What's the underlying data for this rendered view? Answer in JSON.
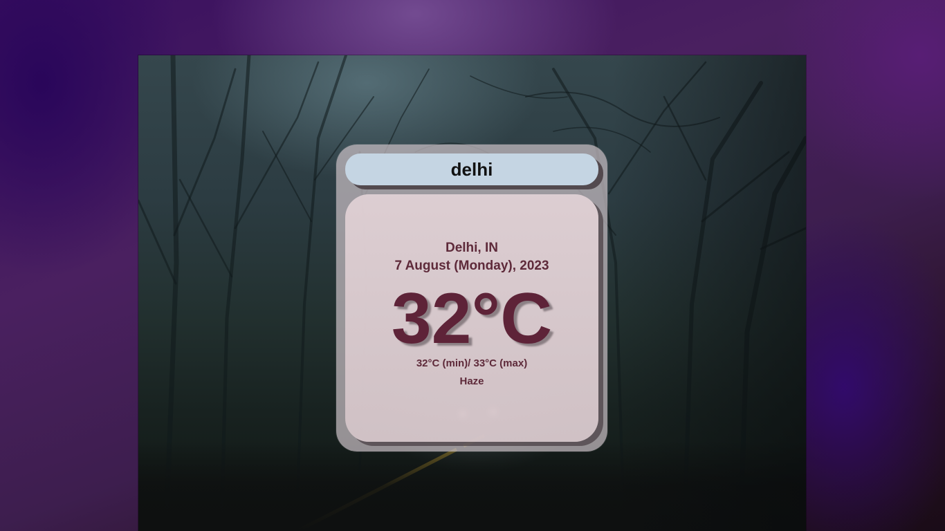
{
  "search": {
    "value": "delhi"
  },
  "weather": {
    "location": "Delhi, IN",
    "date": "7 August (Monday), 2023",
    "temperature": "32°C",
    "min_max": "32°C (min)/ 33°C (max)",
    "condition": "Haze"
  }
}
